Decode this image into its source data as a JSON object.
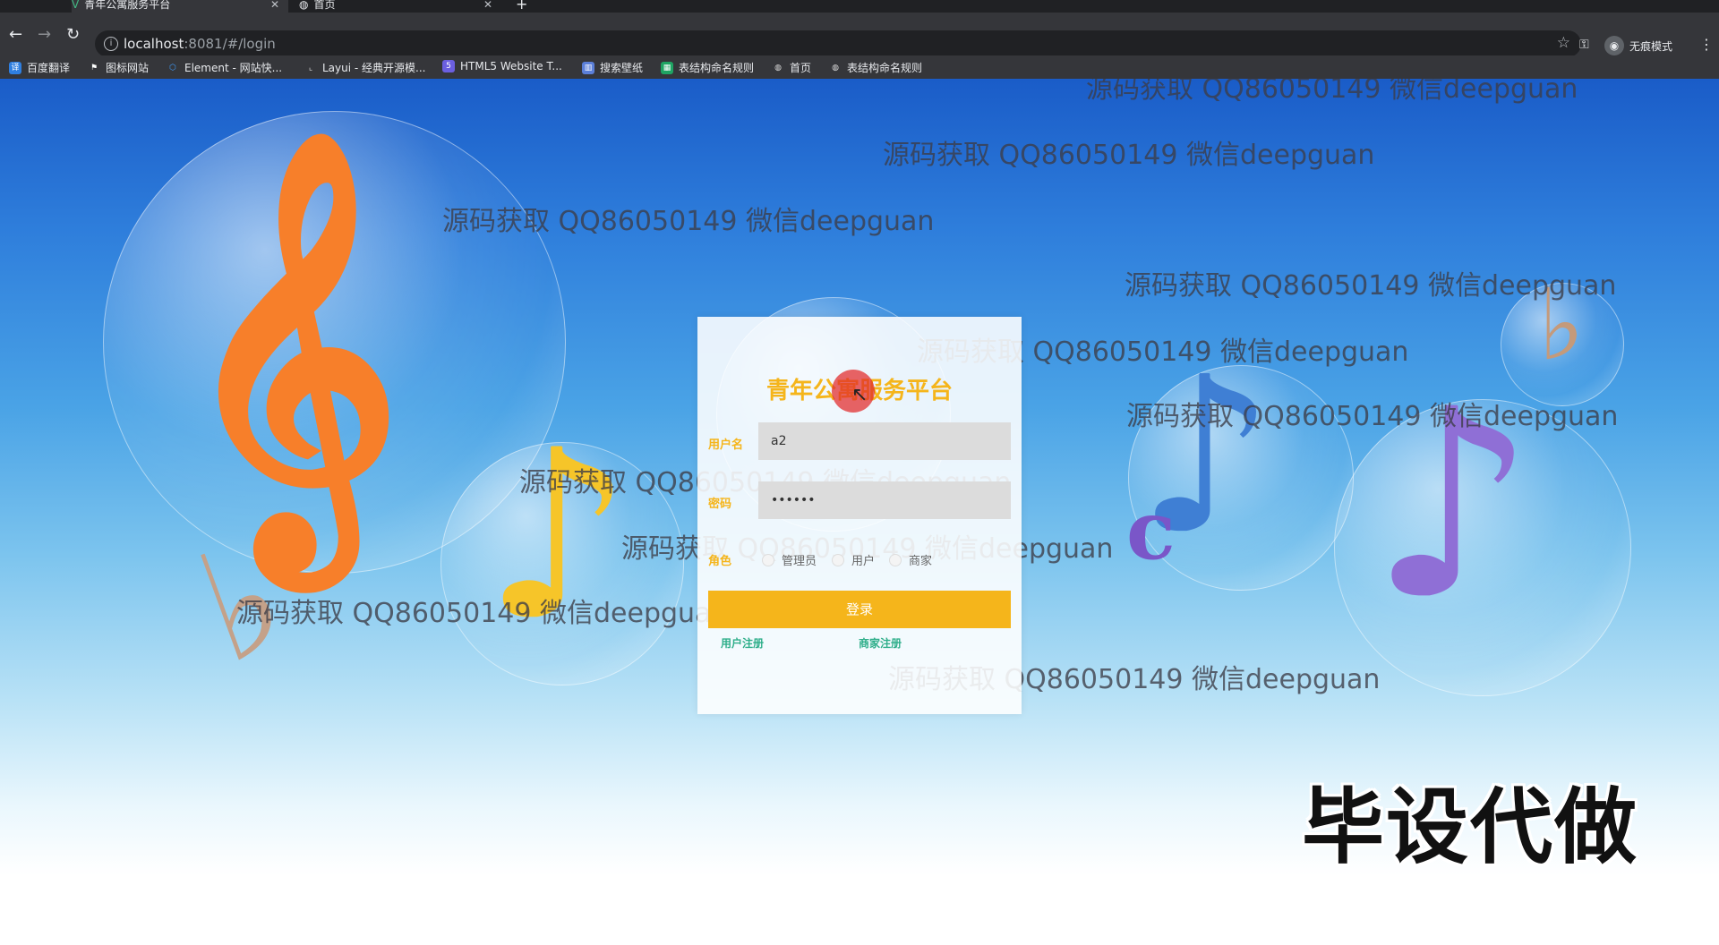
{
  "browser": {
    "tabs": [
      {
        "title": "青年公寓服务平台",
        "active": true
      },
      {
        "title": "首页",
        "active": false
      }
    ],
    "new_tab_symbol": "+",
    "url_host": "localhost",
    "url_rest": ":8081/#/login",
    "incognito_label": "无痕模式",
    "bookmarks": [
      {
        "label": "百度翻译",
        "icon": "translate-icon",
        "color": "#2f7fe0"
      },
      {
        "label": "图标网站",
        "icon": "flag-icon",
        "color": "#ffffff"
      },
      {
        "label": "Element - 网站快...",
        "icon": "element-icon",
        "color": "#409eff"
      },
      {
        "label": "Layui - 经典开源模...",
        "icon": "layui-icon",
        "color": "#dddddd"
      },
      {
        "label": "HTML5 Website T...",
        "icon": "html5-icon",
        "color": "#6b5fe0"
      },
      {
        "label": "搜索壁纸",
        "icon": "wallpaper-icon",
        "color": "#5b7fd8"
      },
      {
        "label": "表结构命名规则",
        "icon": "sheet-icon",
        "color": "#1fa463"
      },
      {
        "label": "首页",
        "icon": "globe-icon",
        "color": "#dddddd"
      },
      {
        "label": "表结构命名规则",
        "icon": "globe-icon",
        "color": "#dddddd"
      }
    ]
  },
  "login": {
    "title": "青年公寓服务平台",
    "username_label": "用户名",
    "username_value": "a2",
    "password_label": "密码",
    "password_value": "••••••",
    "role_label": "角色",
    "roles": [
      "管理员",
      "用户",
      "商家"
    ],
    "login_button": "登录",
    "user_register": "用户注册",
    "merchant_register": "商家注册"
  },
  "watermark_text": "源码获取 QQ86050149 微信deepguan",
  "promo_text": "毕设代做",
  "colors": {
    "accent": "#f5b51b",
    "link": "#2eae8a"
  }
}
